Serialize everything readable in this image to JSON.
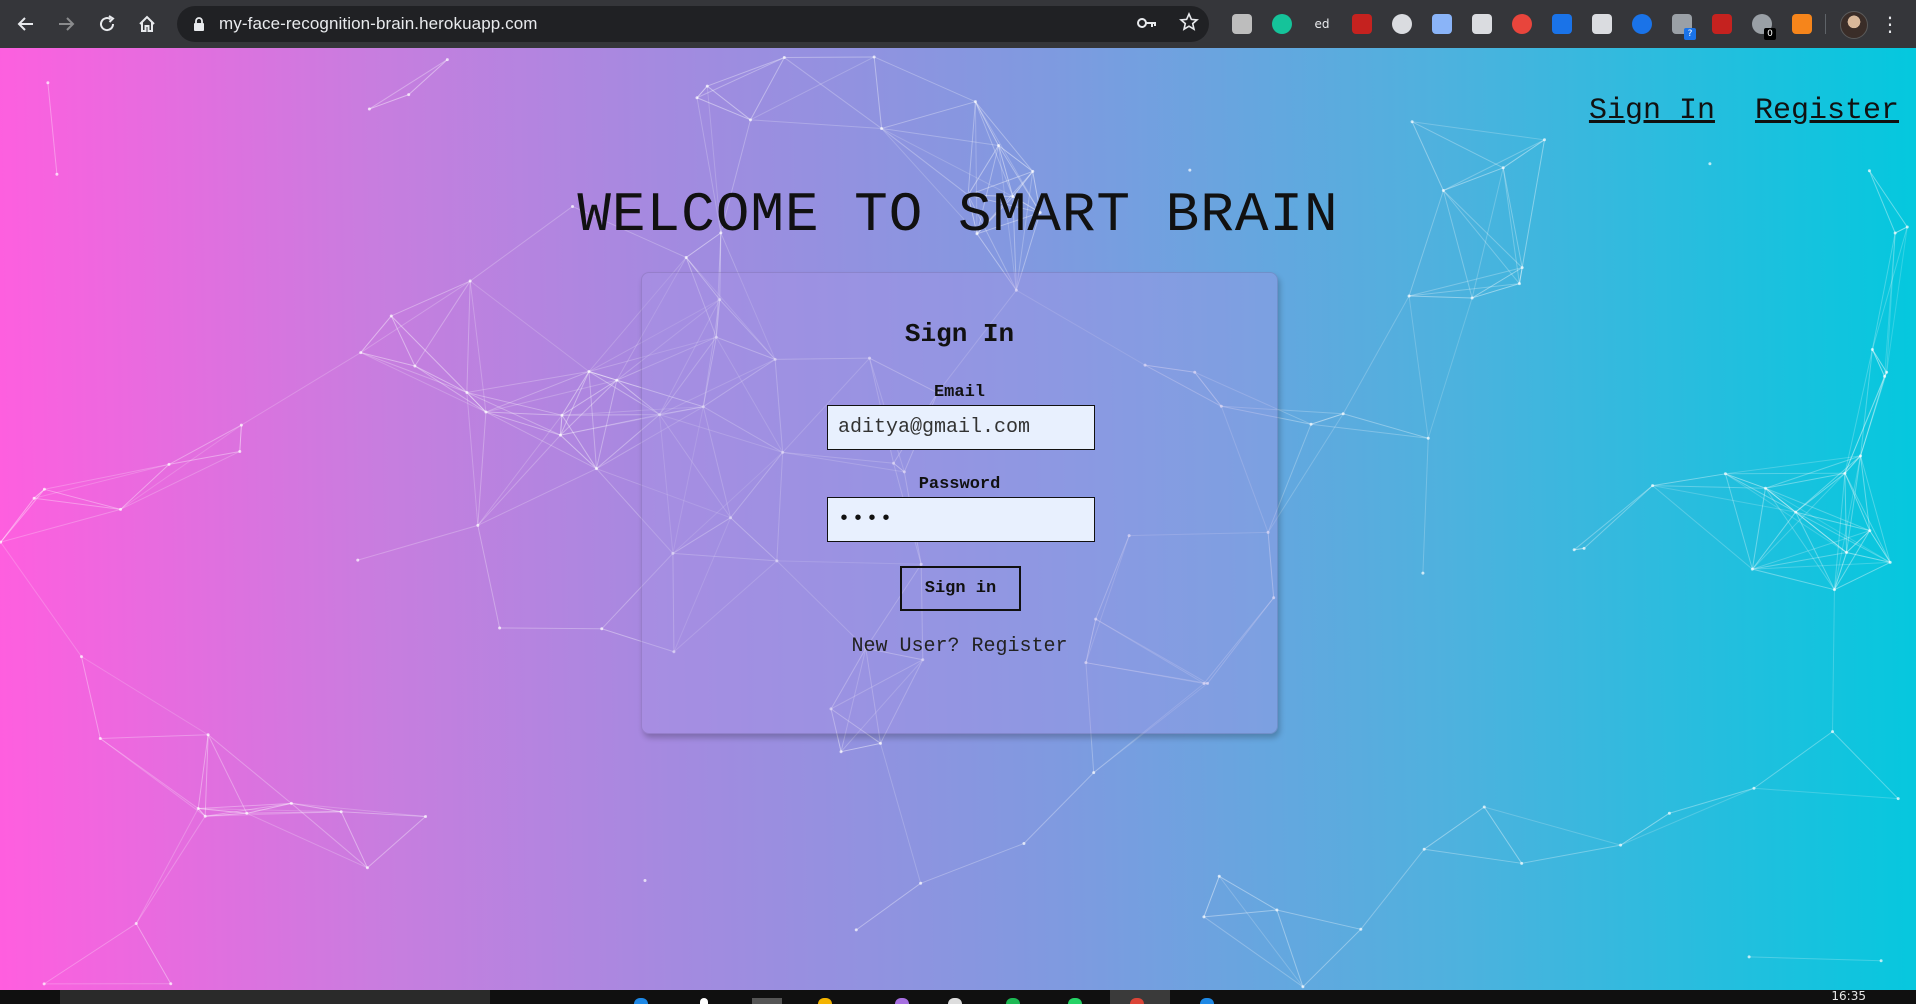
{
  "browser": {
    "url": "my-face-recognition-brain.herokuapp.com",
    "nav": {
      "back_icon": "arrow-left-icon",
      "forward_icon": "arrow-right-icon",
      "reload_icon": "reload-icon",
      "home_icon": "home-icon"
    },
    "extensions": [
      {
        "name": "cube-extension-icon",
        "color": "#bdbdbd"
      },
      {
        "name": "grammarly-icon",
        "color": "#15c39a"
      },
      {
        "name": "ed-extension",
        "label": "ed"
      },
      {
        "name": "pdf-icon",
        "color": "#c5221f"
      },
      {
        "name": "podcast-icon",
        "color": "#dadce0"
      },
      {
        "name": "sync-icon",
        "color": "#8ab4f8"
      },
      {
        "name": "target-icon",
        "color": "#dadce0"
      },
      {
        "name": "react-devtools-icon",
        "color": "#e8453c"
      },
      {
        "name": "info-extension-icon",
        "color": "#1a73e8"
      },
      {
        "name": "cloud-icon",
        "color": "#dadce0"
      },
      {
        "name": "bookmark-extension-icon",
        "color": "#1a73e8"
      },
      {
        "name": "chat-extension-icon",
        "color": "#9aa0a6",
        "badge": "?"
      },
      {
        "name": "flag-extension-icon",
        "color": "#c5221f"
      },
      {
        "name": "counter-extension-icon",
        "color": "#9aa0a6",
        "badge": "0"
      },
      {
        "name": "fox-extension-icon",
        "color": "#f6851b"
      }
    ]
  },
  "page": {
    "nav_links": {
      "sign_in": "Sign In",
      "register": "Register"
    },
    "title": "WELCOME TO SMART BRAIN",
    "form": {
      "heading": "Sign In",
      "email_label": "Email",
      "email_value": "aditya@gmail.com",
      "password_label": "Password",
      "password_mask": "••••",
      "submit_label": "Sign in",
      "register_text": "New User? Register"
    },
    "colors": {
      "gradient_start": "#ff5edf",
      "gradient_end": "#04c8de",
      "input_bg": "#e8f0fe"
    }
  },
  "taskbar": {
    "clock": "16:35"
  }
}
